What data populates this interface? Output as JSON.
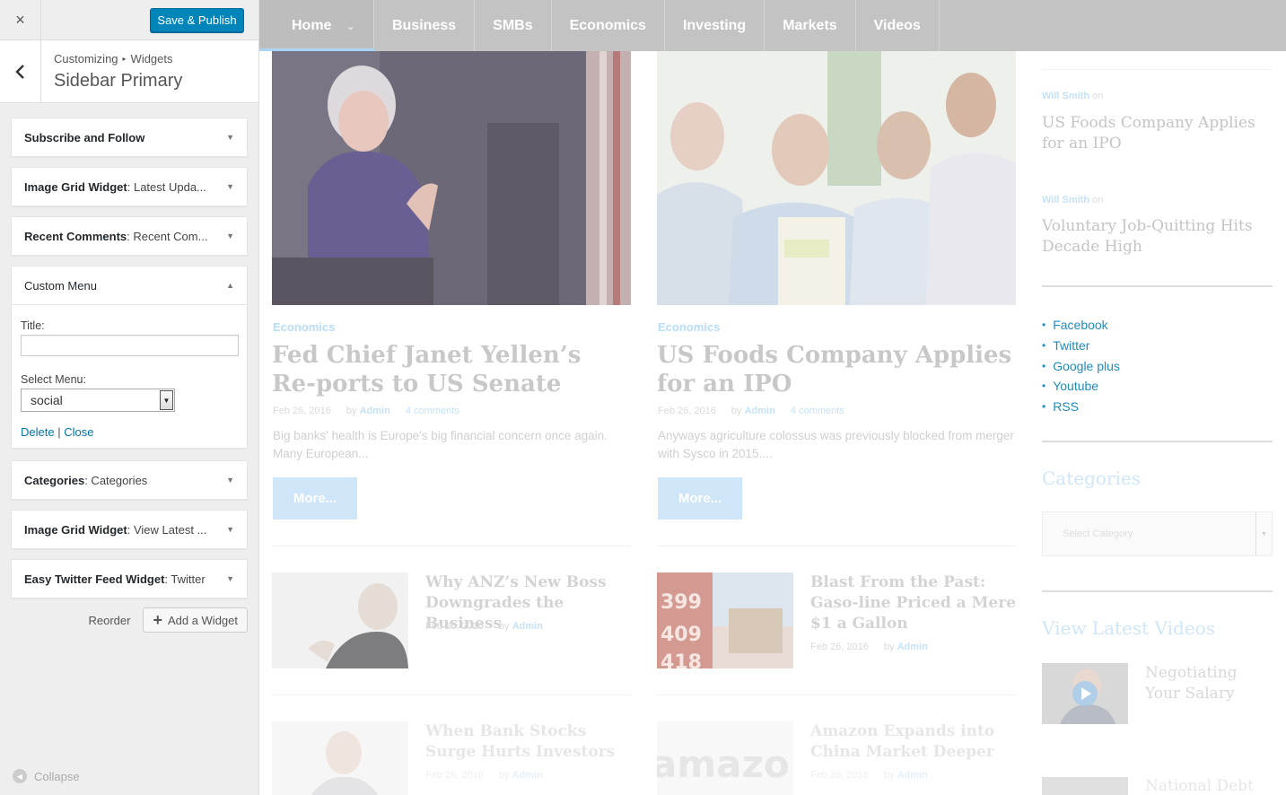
{
  "customizer": {
    "close_icon": "×",
    "save_label": "Save & Publish",
    "back_icon": "‹",
    "breadcrumb": [
      "Customizing",
      "Widgets"
    ],
    "breadcrumb_sep": "▸",
    "section_title": "Sidebar Primary",
    "widgets": [
      {
        "name": "Subscribe and Follow",
        "sub": ""
      },
      {
        "name": "Image Grid Widget",
        "sub": ": Latest Upda..."
      },
      {
        "name": "Recent Comments",
        "sub": ": Recent Com..."
      },
      {
        "name": "Custom Menu",
        "sub": ""
      },
      {
        "name": "Categories",
        "sub": ": Categories"
      },
      {
        "name": "Image Grid Widget",
        "sub": ": View Latest ..."
      },
      {
        "name": "Easy Twitter Feed Widget",
        "sub": ": Twitter"
      }
    ],
    "arrow_down": "▼",
    "arrow_up": "▲",
    "custom_menu_form": {
      "title_label": "Title:",
      "title_value": "",
      "select_label": "Select Menu:",
      "select_value": "social",
      "delete_label": "Delete",
      "link_sep": "|",
      "close_label": "Close"
    },
    "reorder_label": "Reorder",
    "add_widget_label": "Add a Widget",
    "collapse_label": "Collapse"
  },
  "preview": {
    "nav": [
      "Home",
      "Business",
      "SMBs",
      "Economics",
      "Investing",
      "Markets",
      "Videos"
    ],
    "featured": [
      {
        "category": "Economics",
        "title": "Fed Chief Janet Yellen’s Re-ports to US Senate",
        "date": "Feb 26, 2016",
        "by": "by",
        "author": "Admin",
        "comments": "4 comments",
        "excerpt": "Big banks' health is Europe's big financial concern once again. Many European...",
        "more": "More..."
      },
      {
        "category": "Economics",
        "title": "US Foods Company Applies for an IPO",
        "date": "Feb 26, 2016",
        "by": "by",
        "author": "Admin",
        "comments": "4 comments",
        "excerpt": "Anyways agriculture colossus was previously blocked from merger with Sysco in 2015....",
        "more": "More..."
      }
    ],
    "small_posts": [
      {
        "title": "Why ANZ’s New Boss Downgrades the Business",
        "date": "Feb 26, 2016",
        "by": "by",
        "author": "Admin"
      },
      {
        "title": "Blast From the Past: Gaso-line Priced a Mere $1 a Gallon",
        "date": "Feb 26, 2016",
        "by": "by",
        "author": "Admin"
      },
      {
        "title": "When Bank Stocks Surge Hurts Investors",
        "date": "Feb 26, 2016",
        "by": "by",
        "author": "Admin"
      },
      {
        "title": "Amazon Expands into China Market Deeper",
        "date": "Feb 26, 2016",
        "by": "by",
        "author": "Admin"
      }
    ],
    "sidebar": {
      "comments": [
        {
          "author": "Will Smith",
          "on": "on",
          "title": "US Foods Company Applies for an IPO"
        },
        {
          "author": "Will Smith",
          "on": "on",
          "title": "Voluntary Job-Quitting Hits Decade High"
        }
      ],
      "social": [
        "Facebook",
        "Twitter",
        "Google plus",
        "Youtube",
        "RSS"
      ],
      "categories_heading": "Categories",
      "categories_placeholder": "Select Category",
      "videos_heading": "View Latest Videos",
      "videos": [
        "Negotiating Your Salary",
        "National Debt"
      ]
    },
    "image_texts": {
      "gas_prices": [
        "399",
        "409",
        "418"
      ],
      "amazon": "amazo"
    },
    "colors": {
      "nav_bg": "#c3c3c3",
      "accent": "#0085ba",
      "link": "#0073aa"
    }
  }
}
